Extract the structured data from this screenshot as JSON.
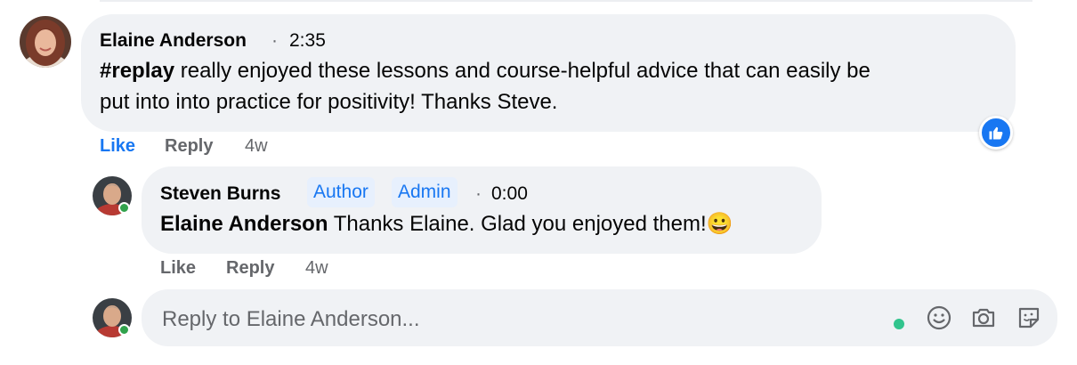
{
  "comment": {
    "author": "Elaine Anderson",
    "separator": "·",
    "time": "2:35",
    "hashtag": "#replay",
    "text_line1": " really enjoyed these lessons and course-helpful advice that can easily be",
    "text_line2": "put into into practice for positivity! Thanks Steve.",
    "actions": {
      "like": "Like",
      "reply": "Reply",
      "age": "4w"
    },
    "liked": true
  },
  "reply": {
    "author": "Steven Burns",
    "badges": [
      "Author",
      "Admin"
    ],
    "separator": "·",
    "time": "0:00",
    "mention": "Elaine Anderson",
    "text": " Thanks Elaine. Glad you enjoyed them!",
    "emoji": "😀",
    "actions": {
      "like": "Like",
      "reply": "Reply",
      "age": "4w"
    }
  },
  "composer": {
    "placeholder": "Reply to Elaine Anderson...",
    "icons": [
      "emoji-icon",
      "camera-icon",
      "sticker-icon"
    ]
  },
  "colors": {
    "accent": "#1877f2",
    "bubble": "#f0f2f5",
    "online": "#31a24c"
  }
}
